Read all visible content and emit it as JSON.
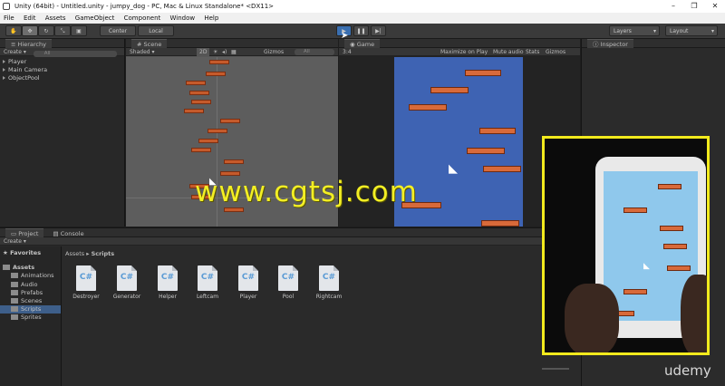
{
  "window": {
    "title": "Unity (64bit) - Untitled.unity - jumpy_dog - PC, Mac & Linux Standalone* <DX11>",
    "controls": [
      "–",
      "❐",
      "✕"
    ]
  },
  "menu": [
    "File",
    "Edit",
    "Assets",
    "GameObject",
    "Component",
    "Window",
    "Help"
  ],
  "toolbar": {
    "pivot_label": "Center",
    "space_label": "Local",
    "layers_label": "Layers",
    "layout_label": "Layout"
  },
  "hierarchy": {
    "tab": "Hierarchy",
    "create_label": "Create",
    "search_placeholder": "All",
    "items": [
      "Player",
      "Main Camera",
      "ObjectPool"
    ]
  },
  "scene": {
    "tab": "Scene",
    "shading": "Shaded",
    "mode_2d": "2D",
    "gizmos": "Gizmos",
    "search_placeholder": "All"
  },
  "game": {
    "tab": "Game",
    "aspect": "3:4",
    "maximize_on_play": "Maximize on Play",
    "mute_audio": "Mute audio",
    "stats": "Stats",
    "gizmos": "Gizmos"
  },
  "inspector": {
    "tab": "Inspector"
  },
  "project": {
    "tab": "Project",
    "console_tab": "Console",
    "create_label": "Create",
    "favorites": "Favorites",
    "assets_root": "Assets",
    "folders": [
      "Animations",
      "Audio",
      "Prefabs",
      "Scenes",
      "Scripts",
      "Sprites"
    ],
    "selected_folder": "Scripts",
    "breadcrumb_root": "Assets",
    "breadcrumb_current": "Scripts",
    "files": [
      "Destroyer",
      "Generator",
      "Helper",
      "Leftcam",
      "Player",
      "Pool",
      "Rightcam"
    ],
    "file_glyph": "C#"
  },
  "overlay": {
    "watermark": "www.cgtsj.com",
    "brand": "udemy"
  }
}
